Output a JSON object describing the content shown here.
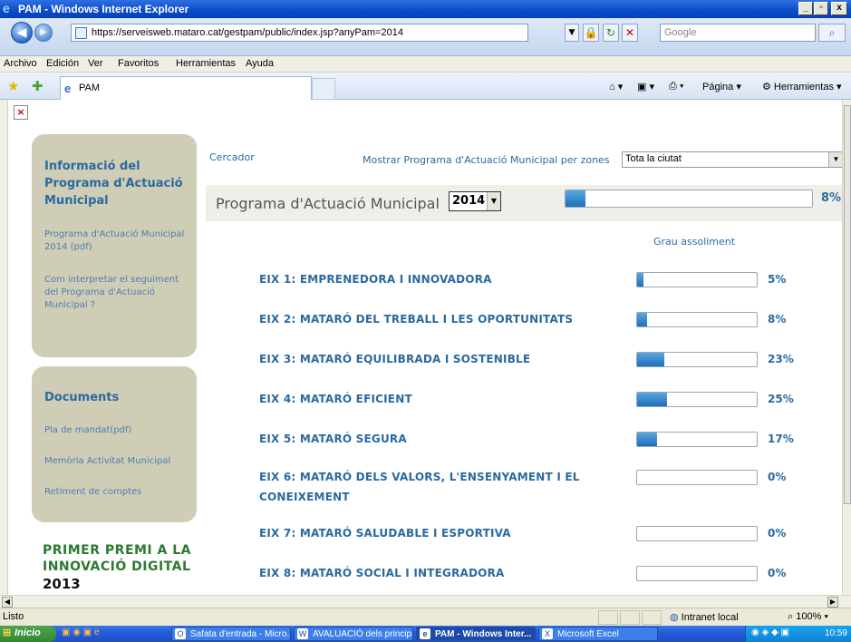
{
  "window": {
    "title": "PAM - Windows Internet Explorer",
    "min": "_",
    "max": "▫",
    "close": "x"
  },
  "address_bar": {
    "url": "https://serveisweb.mataro.cat/gestpam/public/index.jsp?anyPam=2014",
    "search_placeholder": "Google",
    "back": "◀",
    "forward": "▶"
  },
  "menu": [
    "Archivo",
    "Edición",
    "Ver",
    "Favoritos",
    "Herramientas",
    "Ayuda"
  ],
  "tabs": {
    "active_tab": "PAM"
  },
  "command_bar": {
    "page": "Página",
    "tools": "Herramientas"
  },
  "sidebar": {
    "info_panel": {
      "title": "Informació del Programa d'Actuació Municipal",
      "links": [
        "Programa d'Actuació Municipal 2014 (pdf)",
        "Com interpretar el seguiment del Programa d'Actuació Municipal ?"
      ]
    },
    "docs_panel": {
      "title": "Documents",
      "links": [
        "Pla de mandat(pdf)",
        "Memòria Activitat Municipal",
        "Retiment de comptes"
      ]
    },
    "award": {
      "line1": "PRIMER PREMI A LA",
      "line2": "INNOVACIÓ DIGITAL",
      "year": "2013"
    }
  },
  "main": {
    "cercador": "Cercador",
    "zones_label": "Mostrar Programa d'Actuació Municipal per zones",
    "zone_selected": "Tota la ciutat",
    "pam_title": "Programa d'Actuació Municipal",
    "year_selected": "2014",
    "overall_progress": 0.08,
    "overall_pct_label": "8%",
    "grau_label": "Grau assoliment",
    "eixos": [
      {
        "label": "EIX 1: EMPRENEDORA I INNOVADORA",
        "progress": 0.05,
        "pct": "5%"
      },
      {
        "label": "EIX 2: MATARÓ DEL TREBALL I LES OPORTUNITATS",
        "progress": 0.08,
        "pct": "8%"
      },
      {
        "label": "EIX 3: MATARÓ EQUILIBRADA I SOSTENIBLE",
        "progress": 0.23,
        "pct": "23%"
      },
      {
        "label": "EIX 4: MATARÓ EFICIENT",
        "progress": 0.25,
        "pct": "25%"
      },
      {
        "label": "EIX 5: MATARÓ SEGURA",
        "progress": 0.17,
        "pct": "17%"
      },
      {
        "label": "EIX 6: MATARÓ DELS VALORS, L'ENSENYAMENT I EL CONEIXEMENT",
        "progress": 0,
        "pct": "0%"
      },
      {
        "label": "EIX 7: MATARÓ SALUDABLE I ESPORTIVA",
        "progress": 0,
        "pct": "0%"
      },
      {
        "label": "EIX 8: MATARÓ SOCIAL I INTEGRADORA",
        "progress": 0,
        "pct": "0%"
      }
    ]
  },
  "status": {
    "text": "Listo",
    "zone": "Intranet local",
    "zoom": "100%"
  },
  "taskbar": {
    "start": "Inicio",
    "tasks": [
      "Safata d'entrada - Micro...",
      "AVALUACIÓ dels principa...",
      "PAM - Windows Inter...",
      "Microsoft Excel"
    ],
    "clock": "10:59"
  },
  "colors": {
    "link_blue": "#2a6aa0",
    "panel_bg": "#cfcdb5",
    "bar_fill": "#1d6fb8",
    "award_green": "#2a7a30"
  }
}
